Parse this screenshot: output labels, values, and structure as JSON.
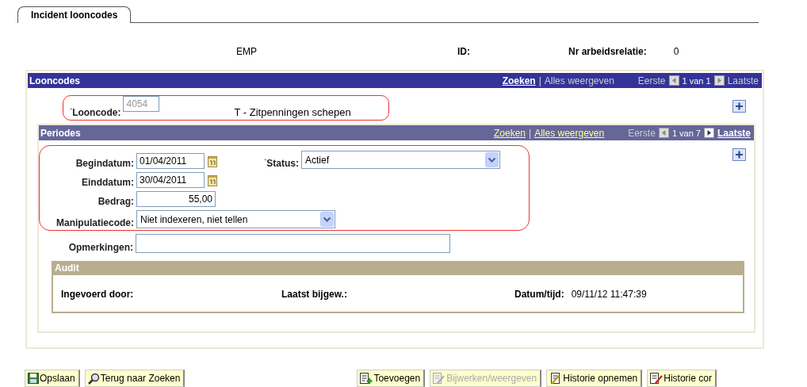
{
  "tab": {
    "label": "Incident looncodes",
    "selected": true
  },
  "header": {
    "emp": "EMP",
    "id_label": "ID:",
    "relation_label": "Nr arbeidsrelatie:",
    "relation_value": "0"
  },
  "looncodes": {
    "title": "Looncodes",
    "nav": {
      "search": {
        "label": "Zoeken",
        "enabled": true
      },
      "separator": "|",
      "view_all": {
        "label": "Alles weergeven",
        "enabled": false
      },
      "first": {
        "label": "Eerste",
        "enabled": false
      },
      "count": "1 van 1",
      "last": {
        "label": "Laatste",
        "enabled": false
      }
    },
    "code_label": "$^{*}$Looncode:",
    "code_value": "4054",
    "code_disabled": true,
    "description": "T - Zitpenningen schepen"
  },
  "periodes": {
    "title": "Periodes",
    "nav": {
      "search": {
        "label": "Zoeken",
        "enabled": true
      },
      "separator": "|",
      "view_all": {
        "label": "Alles weergeven",
        "enabled": true
      },
      "first": {
        "label": "Eerste",
        "enabled": false
      },
      "count": "1 van 7",
      "last": {
        "label": "Laatste",
        "enabled": true
      }
    },
    "fields": [
      {
        "kind": "date",
        "label": "Begindatum:",
        "value": "01/04/2011"
      },
      {
        "kind": "date",
        "label": "Einddatum:",
        "value": "30/04/2011"
      },
      {
        "kind": "number",
        "label": "Bedrag:",
        "value": "55,00"
      },
      {
        "kind": "select",
        "label": "Manipulatiecode:",
        "value": "Niet indexeren, niet tellen"
      }
    ],
    "status": {
      "label": "$^{*}$Status:",
      "value": "Actief"
    },
    "remarks": {
      "label": "Opmerkingen:"
    },
    "audit": {
      "title": "Audit",
      "entered_by_label": "Ingevoerd door:",
      "updated_label": "Laatst bijgew.:",
      "datetime_label": "Datum/tijd:",
      "datetime_value": "09/11/12 11:47:39"
    }
  },
  "buttons": [
    {
      "kind": "save",
      "label": "Opslaan",
      "disabled": false
    },
    {
      "kind": "search",
      "label": "Terug naar Zoeken",
      "disabled": false
    },
    {
      "kind": "add",
      "label": "Toevoegen",
      "disabled": false
    },
    {
      "kind": "edit",
      "label": "Bijwerken/weergeven",
      "disabled": true
    },
    {
      "kind": "history",
      "label": "Historie opnemen",
      "disabled": false
    },
    {
      "kind": "correct",
      "label": "Historie cor",
      "disabled": false
    }
  ]
}
